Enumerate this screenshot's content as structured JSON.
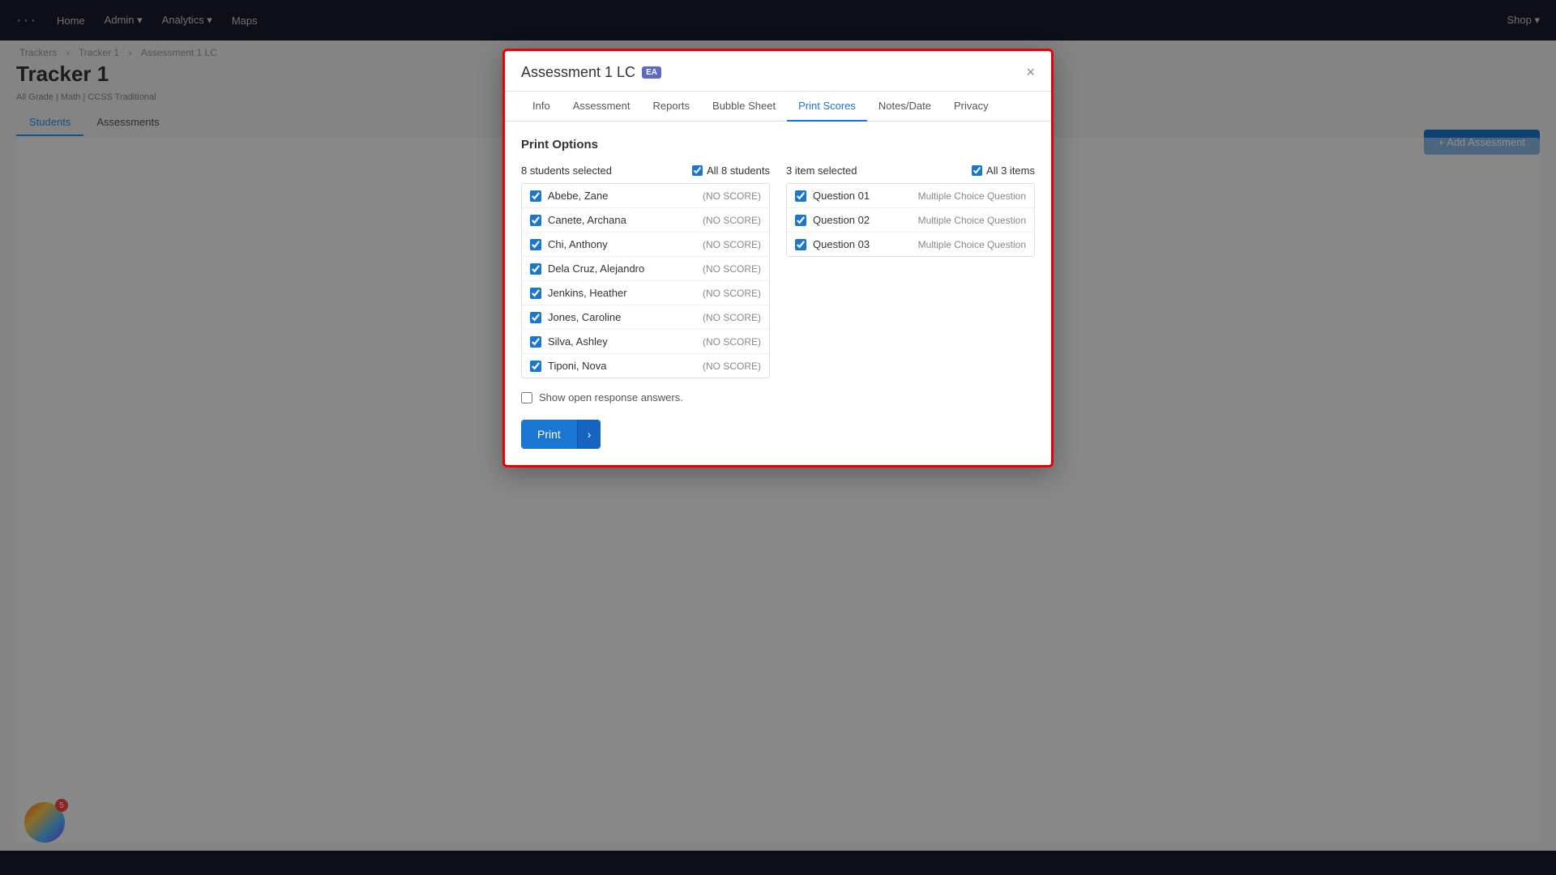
{
  "nav": {
    "logo": "···",
    "items": [
      "Home",
      "Admin ▾",
      "Analytics ▾",
      "Maps"
    ],
    "right_items": [
      "Shop ▾"
    ]
  },
  "breadcrumb": {
    "parts": [
      "Trackers",
      "Tracker 1",
      "Assessment 1 LC"
    ]
  },
  "page": {
    "title": "Tracker 1",
    "subtitle": "All Grade | Math | CCSS Traditional",
    "tabs": [
      "Students",
      "Assessments"
    ],
    "active_tab": "Students",
    "add_button_label": "+ Add Assessment"
  },
  "modal": {
    "title": "Assessment 1 LC",
    "badge": "EA",
    "close_label": "×",
    "tabs": [
      "Info",
      "Assessment",
      "Reports",
      "Bubble Sheet",
      "Print Scores",
      "Notes/Date",
      "Privacy"
    ],
    "active_tab": "Print Scores",
    "body": {
      "print_options_title": "Print Options",
      "students_section": {
        "header_label": "8 students selected",
        "all_label": "All 8 students",
        "students": [
          {
            "name": "Abebe, Zane",
            "score": "(NO SCORE)",
            "checked": true
          },
          {
            "name": "Canete, Archana",
            "score": "(NO SCORE)",
            "checked": true
          },
          {
            "name": "Chi, Anthony",
            "score": "(NO SCORE)",
            "checked": true
          },
          {
            "name": "Dela Cruz, Alejandro",
            "score": "(NO SCORE)",
            "checked": true
          },
          {
            "name": "Jenkins, Heather",
            "score": "(NO SCORE)",
            "checked": true
          },
          {
            "name": "Jones, Caroline",
            "score": "(NO SCORE)",
            "checked": true
          },
          {
            "name": "Silva, Ashley",
            "score": "(NO SCORE)",
            "checked": true
          },
          {
            "name": "Tiponi, Nova",
            "score": "(NO SCORE)",
            "checked": true
          }
        ]
      },
      "questions_section": {
        "header_label": "3 item selected",
        "all_label": "All 3 items",
        "questions": [
          {
            "name": "Question 01",
            "type": "Multiple Choice Question",
            "checked": true
          },
          {
            "name": "Question 02",
            "type": "Multiple Choice Question",
            "checked": true
          },
          {
            "name": "Question 03",
            "type": "Multiple Choice Question",
            "checked": true
          }
        ]
      },
      "show_open_response_label": "Show open response answers.",
      "print_button_label": "Print",
      "print_arrow": "›"
    }
  },
  "floating_badge": {
    "count": "5"
  }
}
